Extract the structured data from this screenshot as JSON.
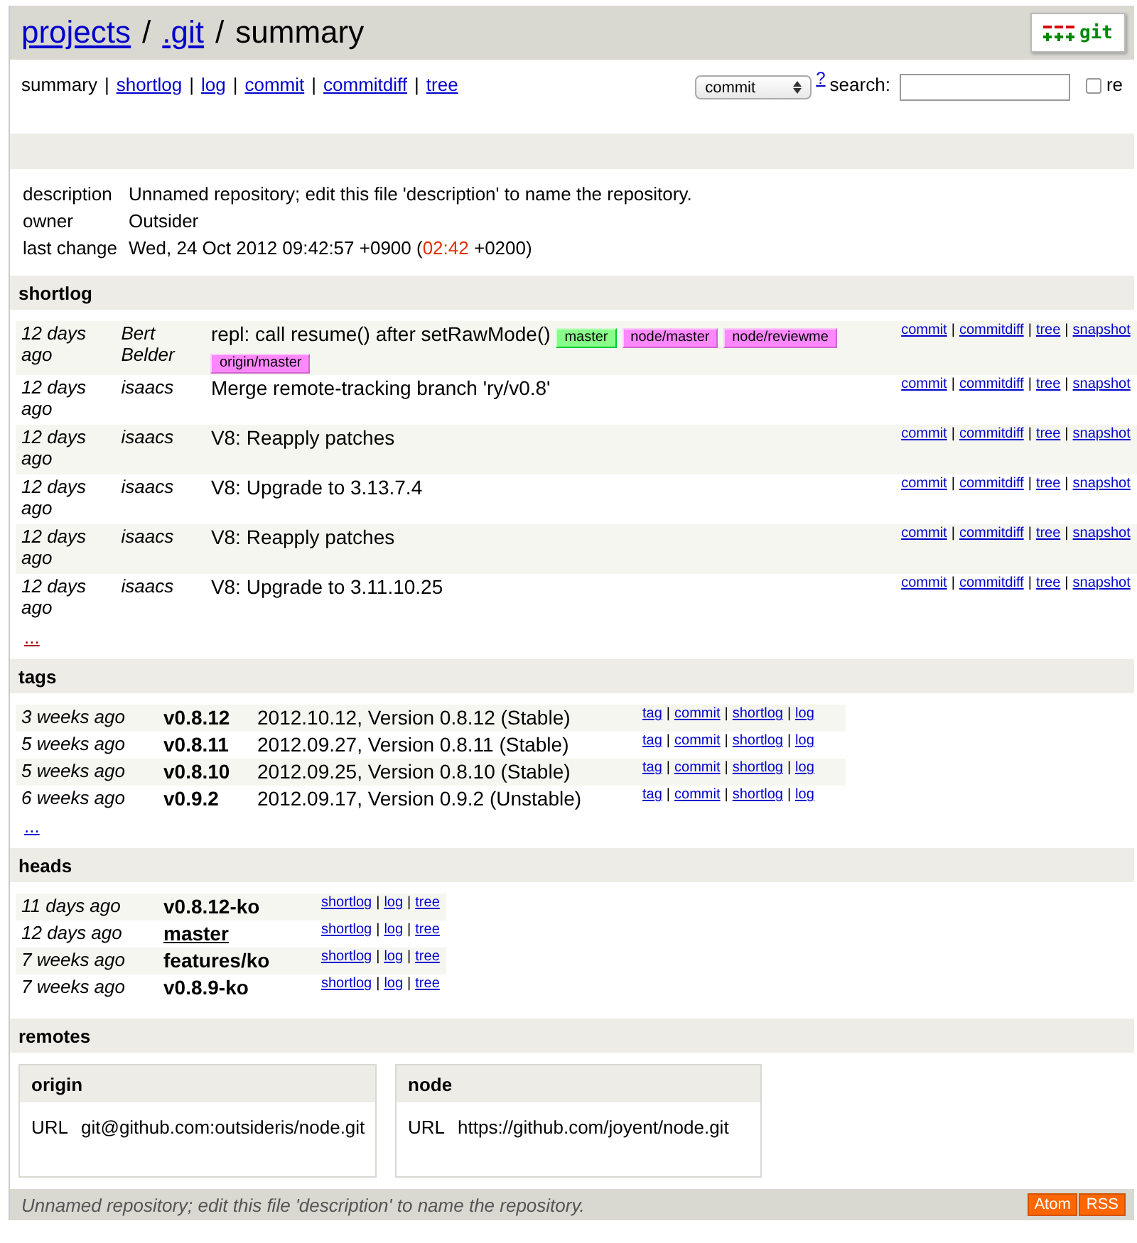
{
  "header": {
    "crumbs": [
      {
        "text": "projects",
        "link": true
      },
      {
        "text": ".git",
        "link": true
      },
      {
        "text": "summary",
        "link": false
      }
    ],
    "separator": "/",
    "logo": "git"
  },
  "nav": {
    "items": [
      {
        "label": "summary",
        "selected": true
      },
      {
        "label": "shortlog",
        "selected": false
      },
      {
        "label": "log",
        "selected": false
      },
      {
        "label": "commit",
        "selected": false
      },
      {
        "label": "commitdiff",
        "selected": false
      },
      {
        "label": "tree",
        "selected": false
      }
    ],
    "separator": "|",
    "search": {
      "type_select": "commit",
      "help": "?",
      "label": "search:",
      "regex": {
        "label": "re",
        "checked": false
      }
    }
  },
  "meta": [
    {
      "label": "description",
      "value": "Unnamed repository; edit this file 'description' to name the repository."
    },
    {
      "label": "owner",
      "value": "Outsider"
    },
    {
      "label": "last change",
      "value": "Wed, 24 Oct 2012 09:42:57 +0900 (",
      "highlight": "02:42",
      "value_after": " +0200)"
    }
  ],
  "shortlog": {
    "title": "shortlog",
    "rows": [
      {
        "age": "12 days ago",
        "author": "Bert Belder",
        "subject": "repl: call resume() after setRawMode()",
        "refs": [
          {
            "name": "master",
            "kind": "head"
          },
          {
            "name": "node/master",
            "kind": "remote"
          },
          {
            "name": "node/reviewme",
            "kind": "remote"
          },
          {
            "name": "origin/master",
            "kind": "remote"
          }
        ],
        "links": [
          "commit",
          "commitdiff",
          "tree",
          "snapshot"
        ]
      },
      {
        "age": "12 days ago",
        "author": "isaacs",
        "subject": "Merge remote-tracking branch 'ry/v0.8'",
        "links": [
          "commit",
          "commitdiff",
          "tree",
          "snapshot"
        ]
      },
      {
        "age": "12 days ago",
        "author": "isaacs",
        "subject": "V8: Reapply patches",
        "links": [
          "commit",
          "commitdiff",
          "tree",
          "snapshot"
        ]
      },
      {
        "age": "12 days ago",
        "author": "isaacs",
        "subject": "V8: Upgrade to 3.13.7.4",
        "links": [
          "commit",
          "commitdiff",
          "tree",
          "snapshot"
        ]
      },
      {
        "age": "12 days ago",
        "author": "isaacs",
        "subject": "V8: Reapply patches",
        "links": [
          "commit",
          "commitdiff",
          "tree",
          "snapshot"
        ]
      },
      {
        "age": "12 days ago",
        "author": "isaacs",
        "subject": "V8: Upgrade to 3.11.10.25",
        "links": [
          "commit",
          "commitdiff",
          "tree",
          "snapshot"
        ]
      }
    ],
    "separator": "|",
    "more": "..."
  },
  "tags": {
    "title": "tags",
    "rows": [
      {
        "age": "3 weeks ago",
        "name": "v0.8.12",
        "comment": "2012.10.12, Version 0.8.12 (Stable)",
        "links": [
          "tag",
          "commit",
          "shortlog",
          "log"
        ]
      },
      {
        "age": "5 weeks ago",
        "name": "v0.8.11",
        "comment": "2012.09.27, Version 0.8.11 (Stable)",
        "links": [
          "tag",
          "commit",
          "shortlog",
          "log"
        ]
      },
      {
        "age": "5 weeks ago",
        "name": "v0.8.10",
        "comment": "2012.09.25, Version 0.8.10 (Stable)",
        "links": [
          "tag",
          "commit",
          "shortlog",
          "log"
        ]
      },
      {
        "age": "6 weeks ago",
        "name": "v0.9.2",
        "comment": "2012.09.17, Version 0.9.2 (Unstable)",
        "links": [
          "tag",
          "commit",
          "shortlog",
          "log"
        ]
      }
    ],
    "separator": "|",
    "more": "..."
  },
  "heads": {
    "title": "heads",
    "rows": [
      {
        "age": "11 days ago",
        "name": "v0.8.12-ko",
        "current": false,
        "links": [
          "shortlog",
          "log",
          "tree"
        ]
      },
      {
        "age": "12 days ago",
        "name": "master",
        "current": true,
        "links": [
          "shortlog",
          "log",
          "tree"
        ]
      },
      {
        "age": "7 weeks ago",
        "name": "features/ko",
        "current": false,
        "links": [
          "shortlog",
          "log",
          "tree"
        ]
      },
      {
        "age": "7 weeks ago",
        "name": "v0.8.9-ko",
        "current": false,
        "links": [
          "shortlog",
          "log",
          "tree"
        ]
      }
    ],
    "separator": "|"
  },
  "remotes": {
    "title": "remotes",
    "items": [
      {
        "name": "origin",
        "url_label": "URL",
        "url": "git@github.com:outsideris/node.git"
      },
      {
        "name": "node",
        "url_label": "URL",
        "url": "https://github.com/joyent/node.git"
      }
    ]
  },
  "footer": {
    "text": "Unnamed repository; edit this file 'description' to name the repository.",
    "feeds": [
      "Atom",
      "RSS"
    ]
  }
}
